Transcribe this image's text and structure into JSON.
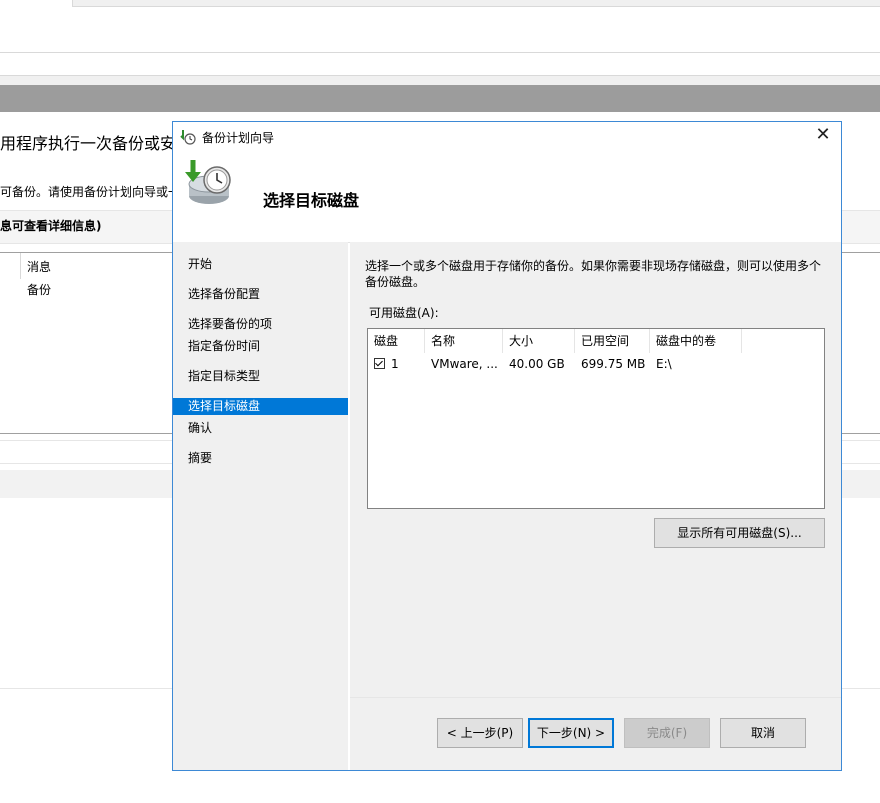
{
  "background": {
    "title": "用程序执行一次备份或安排",
    "description": "可备份。请使用备份计划向导或一",
    "panel_label": "息可查看详细信息)",
    "columns": [
      "消息",
      "备份"
    ]
  },
  "dialog": {
    "window_title": "备份计划向导",
    "close_label": "✕",
    "page_title": "选择目标磁盘",
    "nav_items": [
      "开始",
      "选择备份配置",
      "选择要备份的项",
      "指定备份时间",
      "指定目标类型",
      "选择目标磁盘",
      "确认",
      "摘要"
    ],
    "description": "选择一个或多个磁盘用于存储你的备份。如果你需要非现场存储磁盘，则可以使用多个备份磁盘。",
    "list_label": "可用磁盘(A):",
    "columns": [
      "磁盘",
      "名称",
      "大小",
      "已用空间",
      "磁盘中的卷"
    ],
    "rows": [
      {
        "disk": "1",
        "checked": true,
        "name": "VMware, ...",
        "size": "40.00 GB",
        "used": "699.75 MB",
        "volumes": "E:\\"
      }
    ],
    "show_all_button": "显示所有可用磁盘(S)...",
    "buttons": {
      "back": "< 上一步(P)",
      "next": "下一步(N) >",
      "finish": "完成(F)",
      "cancel": "取消"
    }
  },
  "colors": {
    "accent": "#0078d7",
    "window_border": "#3d89d5",
    "panel_bg": "#f0f0f0",
    "header_bar": "#9c9c9c"
  },
  "icons": {
    "app": "backup-schedule-icon",
    "header": "disk-backup-clock-icon",
    "close": "close-icon",
    "checkbox": "checkbox-checked-icon"
  }
}
